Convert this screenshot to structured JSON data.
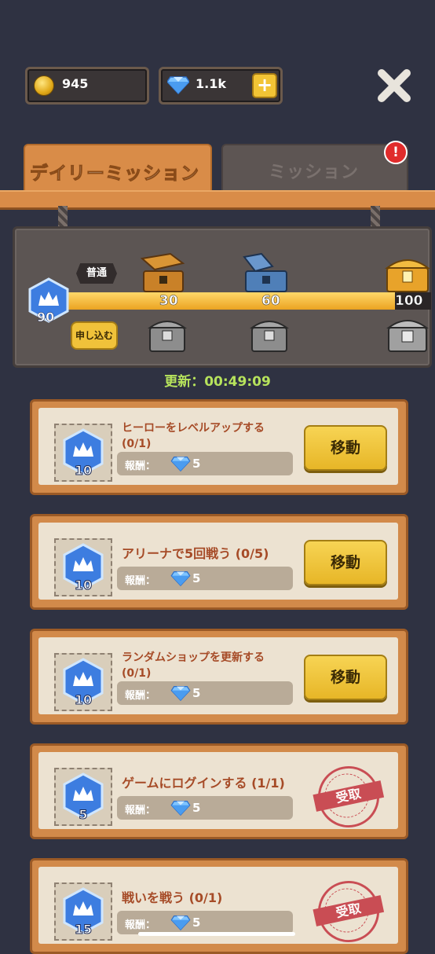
{
  "currency": {
    "gold": "945",
    "gems": "1.1k",
    "plus_label": "+"
  },
  "tabs": {
    "daily": "デイリーミッション",
    "mission": "ミッション",
    "alert": "!"
  },
  "progress": {
    "difficulty": "普通",
    "points": "90",
    "apply_label": "申し込む",
    "milestones": [
      "30",
      "60",
      "100"
    ],
    "fill_fraction": 0.9,
    "timer": "更新：00:49:09"
  },
  "missions": [
    {
      "title_line1": "ヒーローをレベルアップする",
      "title_line2": "(0/1)",
      "icon_value": "10",
      "reward_label": "報酬：",
      "reward": "5",
      "action": "移動"
    },
    {
      "title_line1": "アリーナで5回戦う (0/5)",
      "title_line2": "",
      "icon_value": "10",
      "reward_label": "報酬：",
      "reward": "5",
      "action": "移動"
    },
    {
      "title_line1": "ランダムショップを更新する",
      "title_line2": "(0/1)",
      "icon_value": "10",
      "reward_label": "報酬：",
      "reward": "5",
      "action": "移動"
    },
    {
      "title_line1": "ゲームにログインする (1/1)",
      "title_line2": "",
      "icon_value": "5",
      "reward_label": "報酬：",
      "reward": "5",
      "action": "受取"
    },
    {
      "title_line1": "戦いを戦う (0/1)",
      "title_line2": "",
      "icon_value": "15",
      "reward_label": "報酬：",
      "reward": "5",
      "action": "受取"
    }
  ],
  "colors": {
    "background": "#2f3242",
    "tab_active": "#d98c48",
    "button_yellow": "#f2c435",
    "stamp_red": "#c4343f",
    "timer_green": "#b7e35c"
  }
}
